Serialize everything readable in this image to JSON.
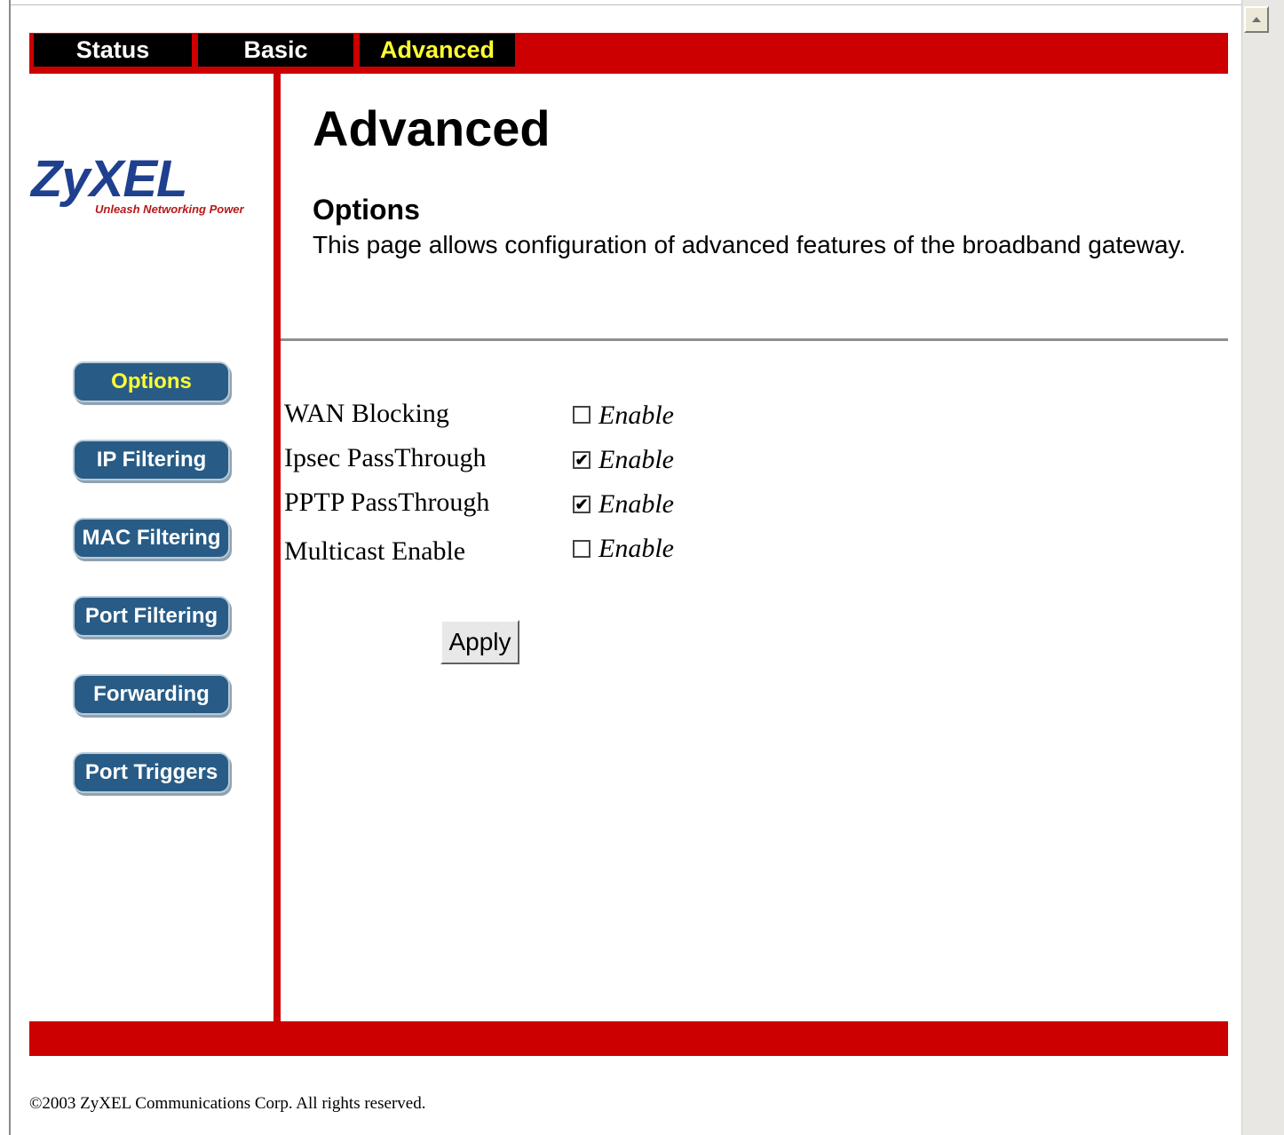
{
  "nav": {
    "tabs": [
      {
        "label": "Status",
        "active": false
      },
      {
        "label": "Basic",
        "active": false
      },
      {
        "label": "Advanced",
        "active": true
      }
    ]
  },
  "logo": {
    "brand": "ZyXEL",
    "tagline": "Unleash Networking Power"
  },
  "sidebar": {
    "items": [
      {
        "label": "Options",
        "active": true
      },
      {
        "label": "IP Filtering",
        "active": false
      },
      {
        "label": "MAC Filtering",
        "active": false
      },
      {
        "label": "Port Filtering",
        "active": false
      },
      {
        "label": "Forwarding",
        "active": false
      },
      {
        "label": "Port Triggers",
        "active": false
      }
    ]
  },
  "main": {
    "title": "Advanced",
    "section_title": "Options",
    "section_description": "This page allows configuration of advanced features of the broadband gateway."
  },
  "options": [
    {
      "label": "WAN Blocking",
      "checked": false,
      "enable_label": "Enable"
    },
    {
      "label": "Ipsec PassThrough",
      "checked": true,
      "enable_label": "Enable"
    },
    {
      "label": "PPTP PassThrough",
      "checked": true,
      "enable_label": "Enable"
    },
    {
      "label": "Multicast Enable",
      "checked": false,
      "enable_label": "Enable"
    }
  ],
  "apply_label": "Apply",
  "footer": "©2003 ZyXEL Communications Corp.  All rights reserved.",
  "colors": {
    "brand_red": "#cc0000",
    "nav_active_text": "#ffff33",
    "sidebar_button": "#285c86",
    "logo_blue": "#1f3f8f"
  }
}
